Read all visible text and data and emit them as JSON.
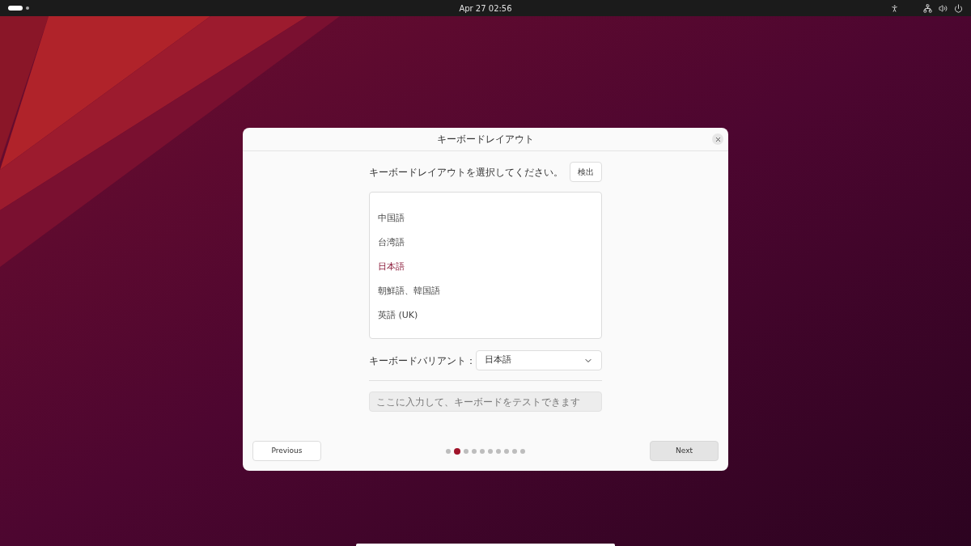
{
  "top_bar": {
    "clock": "Apr 27  02:56"
  },
  "dialog": {
    "title": "キーボードレイアウト",
    "prompt": "キーボードレイアウトを選択してください。",
    "detect_button": "検出",
    "layouts": [
      {
        "label": "中国語",
        "selected": false
      },
      {
        "label": "台湾語",
        "selected": false
      },
      {
        "label": "日本語",
        "selected": true
      },
      {
        "label": "朝鮮語、韓国語",
        "selected": false
      },
      {
        "label": "英語 (UK)",
        "selected": false
      }
    ],
    "variant_label": "キーボードバリアント：",
    "variant_value": "日本語",
    "test_field": {
      "placeholder": "ここに入力して、キーボードをテストできます"
    },
    "previous_button": "Previous",
    "next_button": "Next",
    "steps": [
      {
        "selected": false
      },
      {
        "selected": true
      },
      {
        "selected": false
      },
      {
        "selected": false
      },
      {
        "selected": false
      },
      {
        "selected": false
      },
      {
        "selected": false
      },
      {
        "selected": false
      },
      {
        "selected": false
      },
      {
        "selected": false
      }
    ]
  }
}
